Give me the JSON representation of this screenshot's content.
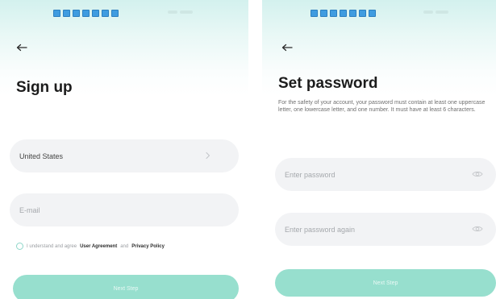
{
  "signup": {
    "title": "Sign up",
    "country_value": "United States",
    "email_placeholder": "E-mail",
    "agreement": {
      "prefix": "I understand and agree",
      "user_agreement": "User Agreement",
      "conjunction": "and",
      "privacy_policy": "Privacy Policy"
    },
    "next_label": "Next Step"
  },
  "set_password": {
    "title": "Set password",
    "description": "For the safety of your account, your password must contain at least one uppercase letter, one lowercase letter, and one number. It must have at least 6 characters.",
    "password_placeholder": "Enter password",
    "password_again_placeholder": "Enter password again",
    "next_label": "Next Step"
  },
  "colors": {
    "accent": "#97dfce",
    "field_bg": "#f2f3f5",
    "header_tint": "#d3f1ee"
  },
  "icons": {
    "back": "arrow-left-icon",
    "country_select": "chevron-right-icon",
    "password_visibility": "eye-icon",
    "agreement_checkbox": "radio-circle-icon"
  }
}
